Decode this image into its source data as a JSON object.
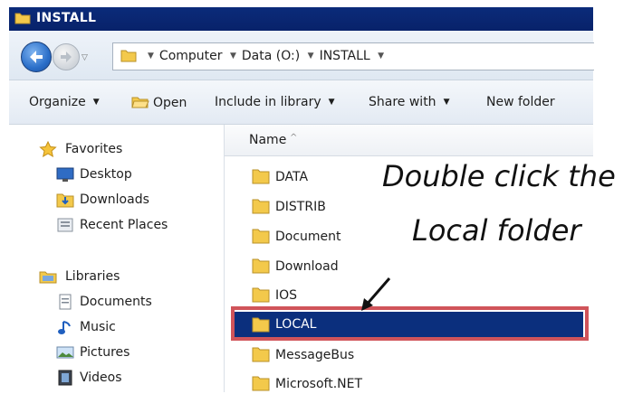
{
  "window": {
    "title": "INSTALL"
  },
  "address": {
    "crumbs": [
      "Computer",
      "Data (O:)",
      "INSTALL"
    ]
  },
  "toolbar": {
    "organize": "Organize",
    "open": "Open",
    "include_in_library": "Include in library",
    "share_with": "Share with",
    "new_folder": "New folder"
  },
  "nav": {
    "favorites": {
      "label": "Favorites",
      "items": [
        "Desktop",
        "Downloads",
        "Recent Places"
      ]
    },
    "libraries": {
      "label": "Libraries",
      "items": [
        "Documents",
        "Music",
        "Pictures",
        "Videos"
      ]
    }
  },
  "content": {
    "column_name": "Name",
    "sort_glyph": "^",
    "folders": [
      "DATA",
      "DISTRIB",
      "Document",
      "Download",
      "IOS",
      "LOCAL",
      "MessageBus",
      "Microsoft.NET"
    ],
    "selected": "LOCAL"
  },
  "annotation": {
    "line1": "Double click the",
    "line2": "Local folder"
  },
  "colors": {
    "selection": "#0b2f7d",
    "highlight_border": "#d0545a",
    "title_bar": "#0b2b7a"
  }
}
